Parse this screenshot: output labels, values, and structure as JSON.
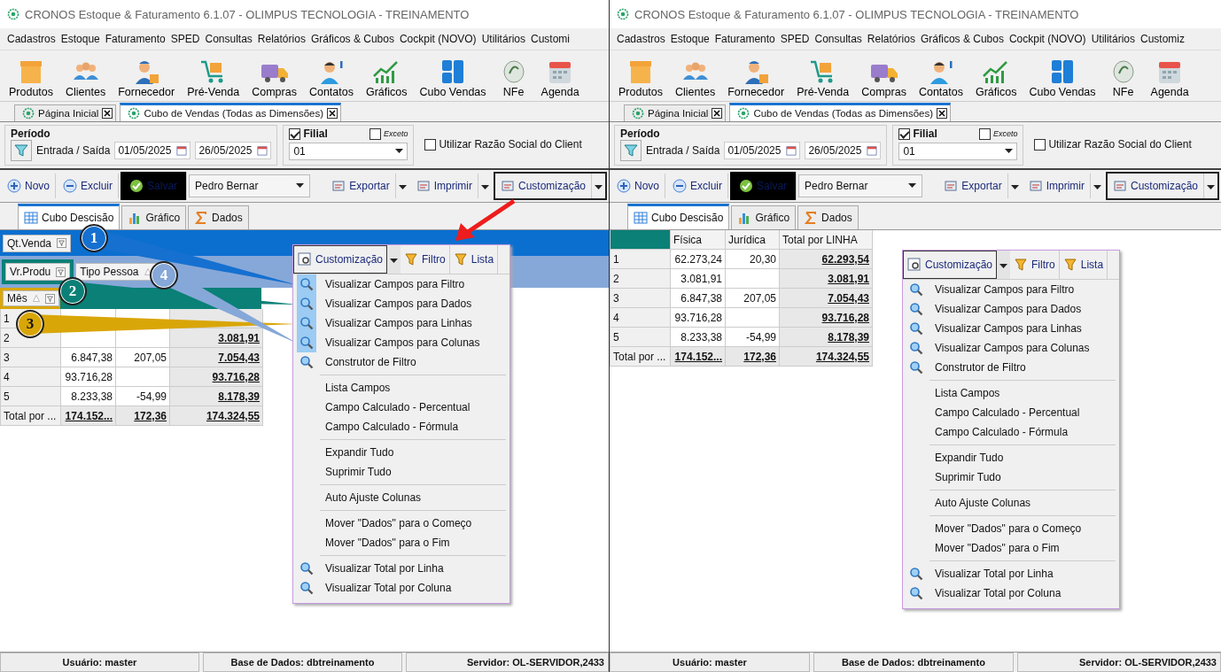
{
  "panels": [
    {
      "window_title": "CRONOS Estoque & Faturamento 6.1.07 - OLIMPUS TECNOLOGIA - TREINAMENTO",
      "menu": [
        "Cadastros",
        "Estoque",
        "Faturamento",
        "SPED",
        "Consultas",
        "Relatórios",
        "Gráficos & Cubos",
        "Cockpit (NOVO)",
        "Utilitários",
        "Customi"
      ],
      "toolbar": [
        "Produtos",
        "Clientes",
        "Fornecedor",
        "Pré-Venda",
        "Compras",
        "Contatos",
        "Gráficos",
        "Cubo Vendas",
        "NFe",
        "Agenda"
      ],
      "doc_tabs": [
        {
          "label": "Página Inicial",
          "selected": false
        },
        {
          "label": "Cubo de Vendas (Todas as Dimensões)",
          "selected": true
        }
      ],
      "period": {
        "title": "Período",
        "label": "Entrada / Saída",
        "date_from": "01/05/2025",
        "date_to": "26/05/2025"
      },
      "filial": {
        "label": "Filial",
        "checked": true,
        "except_label": "Exceto",
        "except_checked": false,
        "value": "01"
      },
      "razao": {
        "label": "Utilizar Razão Social do Client",
        "checked": false
      },
      "actions": [
        {
          "kind": "button",
          "label": "Novo"
        },
        {
          "kind": "button",
          "label": "Excluir"
        },
        {
          "kind": "dark",
          "label": "Salvar"
        },
        {
          "kind": "combo",
          "label": "Pedro Bernar"
        },
        {
          "kind": "split",
          "label": "Exportar"
        },
        {
          "kind": "split",
          "label": "Imprimir"
        },
        {
          "kind": "split",
          "label": "Customização"
        }
      ],
      "view_tabs": [
        {
          "label": "Cubo Descisão",
          "selected": true
        },
        {
          "label": "Gráfico",
          "selected": false
        },
        {
          "label": "Dados",
          "selected": false
        }
      ],
      "field_areas": {
        "filter": "Qt.Venda",
        "data": "Vr.Produ",
        "column": "Tipo Pessoa",
        "row": "Mês"
      },
      "callouts": [
        "1",
        "2",
        "3",
        "4"
      ],
      "grid": {
        "rows": [
          {
            "label": "1",
            "cells": [
              null,
              null,
              null
            ]
          },
          {
            "label": "2",
            "cells": [
              null,
              null,
              "3.081,91"
            ]
          },
          {
            "label": "3",
            "cells": [
              "6.847,38",
              "207,05",
              "7.054,43"
            ]
          },
          {
            "label": "4",
            "cells": [
              "93.716,28",
              "",
              "93.716,28"
            ]
          },
          {
            "label": "5",
            "cells": [
              "8.233,38",
              "-54,99",
              "8.178,39"
            ]
          }
        ],
        "total": {
          "label": "Total por ...",
          "cells": [
            "174.152...",
            "172,36",
            "174.324,55"
          ]
        }
      },
      "popup": {
        "buttons": [
          "Customização",
          "Filtro",
          "Lista"
        ],
        "groups": [
          [
            {
              "label": "Visualizar Campos para Filtro",
              "icon": true,
              "highlighted": true
            },
            {
              "label": "Visualizar Campos para Dados",
              "icon": true,
              "highlighted": true
            },
            {
              "label": "Visualizar Campos para Linhas",
              "icon": true,
              "highlighted": true
            },
            {
              "label": "Visualizar Campos para Colunas",
              "icon": true,
              "highlighted": true
            },
            {
              "label": "Construtor de Filtro",
              "icon": true,
              "highlighted": false
            }
          ],
          [
            {
              "label": "Lista Campos",
              "icon": false,
              "highlighted": false
            },
            {
              "label": "Campo Calculado - Percentual",
              "icon": false,
              "highlighted": false
            },
            {
              "label": "Campo Calculado - Fórmula",
              "icon": false,
              "highlighted": false
            }
          ],
          [
            {
              "label": "Expandir Tudo",
              "icon": false,
              "highlighted": false
            },
            {
              "label": "Suprimir Tudo",
              "icon": false,
              "highlighted": false
            }
          ],
          [
            {
              "label": "Auto Ajuste Colunas",
              "icon": false,
              "highlighted": false
            }
          ],
          [
            {
              "label": "Mover \"Dados\" para o Começo",
              "icon": false,
              "highlighted": false
            },
            {
              "label": "Mover \"Dados\" para o Fim",
              "icon": false,
              "highlighted": false
            }
          ],
          [
            {
              "label": "Visualizar Total por Linha",
              "icon": true,
              "highlighted": false
            },
            {
              "label": "Visualizar Total por Coluna",
              "icon": true,
              "highlighted": false
            }
          ]
        ]
      },
      "status_bar": [
        "Usuário: master",
        "Base de Dados: dbtreinamento",
        "Servidor: OL-SERVIDOR,2433"
      ]
    },
    {
      "window_title": "CRONOS Estoque & Faturamento 6.1.07 - OLIMPUS TECNOLOGIA - TREINAMENTO",
      "menu": [
        "Cadastros",
        "Estoque",
        "Faturamento",
        "SPED",
        "Consultas",
        "Relatórios",
        "Gráficos & Cubos",
        "Cockpit (NOVO)",
        "Utilitários",
        "Customiz"
      ],
      "toolbar": [
        "Produtos",
        "Clientes",
        "Fornecedor",
        "Pré-Venda",
        "Compras",
        "Contatos",
        "Gráficos",
        "Cubo Vendas",
        "NFe",
        "Agenda"
      ],
      "doc_tabs": [
        {
          "label": "Página Inicial",
          "selected": false
        },
        {
          "label": "Cubo de Vendas (Todas as Dimensões)",
          "selected": true
        }
      ],
      "period": {
        "title": "Período",
        "label": "Entrada / Saída",
        "date_from": "01/05/2025",
        "date_to": "26/05/2025"
      },
      "filial": {
        "label": "Filial",
        "checked": true,
        "except_label": "Exceto",
        "except_checked": false,
        "value": "01"
      },
      "razao": {
        "label": "Utilizar Razão Social do Client",
        "checked": false
      },
      "actions": [
        {
          "kind": "button",
          "label": "Novo"
        },
        {
          "kind": "button",
          "label": "Excluir"
        },
        {
          "kind": "dark",
          "label": "Salvar"
        },
        {
          "kind": "combo",
          "label": "Pedro Bernar"
        },
        {
          "kind": "split",
          "label": "Exportar"
        },
        {
          "kind": "split",
          "label": "Imprimir"
        },
        {
          "kind": "split",
          "label": "Customização"
        }
      ],
      "view_tabs": [
        {
          "label": "Cubo Descisão",
          "selected": true
        },
        {
          "label": "Gráfico",
          "selected": false
        },
        {
          "label": "Dados",
          "selected": false
        }
      ],
      "grid": {
        "columns": [
          "Física",
          "Jurídica",
          "Total por LINHA"
        ],
        "rows": [
          {
            "label": "1",
            "cells": [
              "62.273,24",
              "20,30",
              "62.293,54"
            ]
          },
          {
            "label": "2",
            "cells": [
              "3.081,91",
              "",
              "3.081,91"
            ]
          },
          {
            "label": "3",
            "cells": [
              "6.847,38",
              "207,05",
              "7.054,43"
            ]
          },
          {
            "label": "4",
            "cells": [
              "93.716,28",
              "",
              "93.716,28"
            ]
          },
          {
            "label": "5",
            "cells": [
              "8.233,38",
              "-54,99",
              "8.178,39"
            ]
          }
        ],
        "total": {
          "label": "Total por ...",
          "cells": [
            "174.152...",
            "172,36",
            "174.324,55"
          ]
        }
      },
      "popup": {
        "buttons": [
          "Customização",
          "Filtro",
          "Lista"
        ],
        "groups": [
          [
            {
              "label": "Visualizar Campos para Filtro",
              "icon": true,
              "highlighted": false
            },
            {
              "label": "Visualizar Campos para Dados",
              "icon": true,
              "highlighted": false
            },
            {
              "label": "Visualizar Campos para Linhas",
              "icon": true,
              "highlighted": false
            },
            {
              "label": "Visualizar Campos para Colunas",
              "icon": true,
              "highlighted": false
            },
            {
              "label": "Construtor de Filtro",
              "icon": true,
              "highlighted": false
            }
          ],
          [
            {
              "label": "Lista Campos",
              "icon": false,
              "highlighted": false
            },
            {
              "label": "Campo Calculado - Percentual",
              "icon": false,
              "highlighted": false
            },
            {
              "label": "Campo Calculado - Fórmula",
              "icon": false,
              "highlighted": false
            }
          ],
          [
            {
              "label": "Expandir Tudo",
              "icon": false,
              "highlighted": false
            },
            {
              "label": "Suprimir Tudo",
              "icon": false,
              "highlighted": false
            }
          ],
          [
            {
              "label": "Auto Ajuste Colunas",
              "icon": false,
              "highlighted": false
            }
          ],
          [
            {
              "label": "Mover \"Dados\" para o Começo",
              "icon": false,
              "highlighted": false
            },
            {
              "label": "Mover \"Dados\" para o Fim",
              "icon": false,
              "highlighted": false
            }
          ],
          [
            {
              "label": "Visualizar Total por Linha",
              "icon": true,
              "highlighted": false
            },
            {
              "label": "Visualizar Total por Coluna",
              "icon": true,
              "highlighted": false
            }
          ]
        ]
      },
      "status_bar": [
        "Usuário: master",
        "Base de Dados: dbtreinamento",
        "Servidor: OL-SERVIDOR,2433"
      ]
    }
  ]
}
